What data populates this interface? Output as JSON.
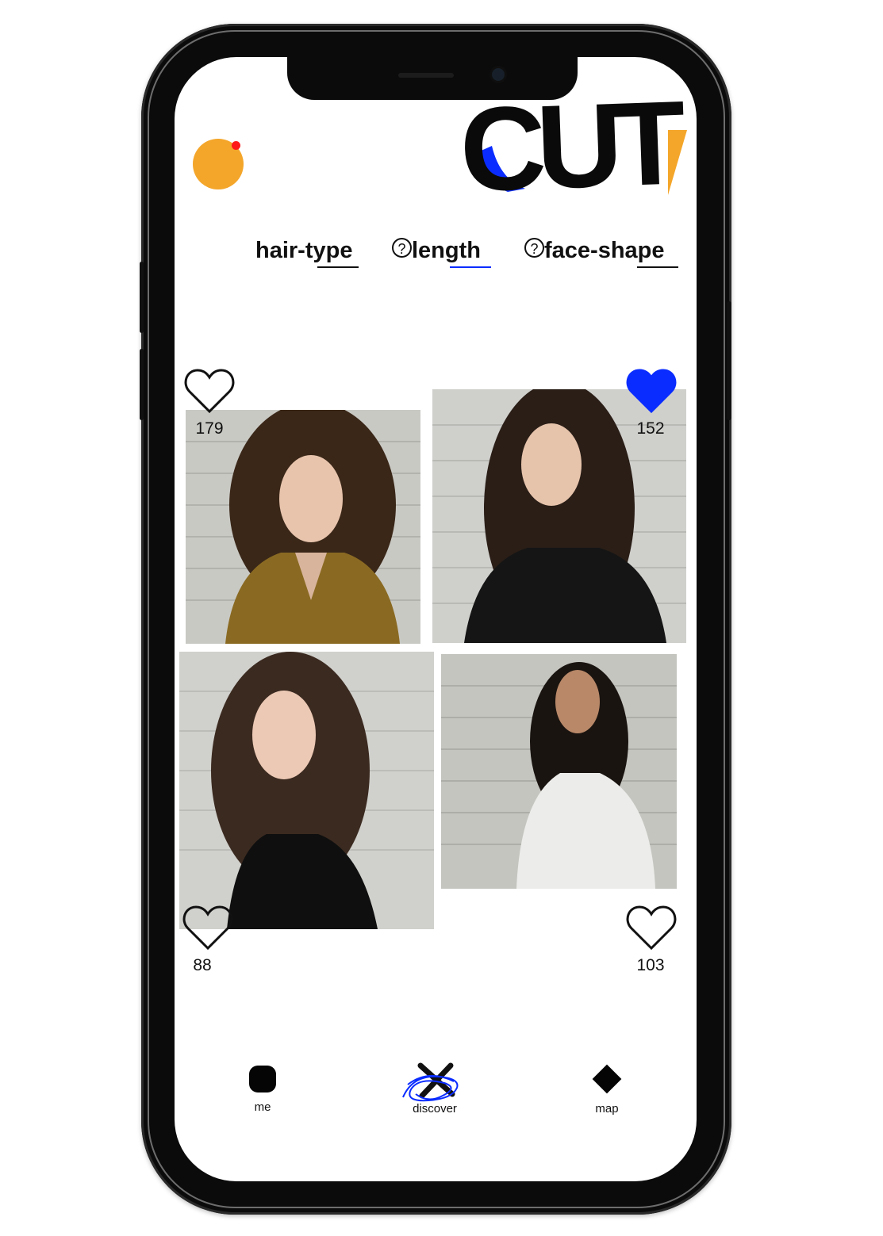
{
  "app": {
    "logo_text": "CUT"
  },
  "colors": {
    "accent_orange": "#f4a62a",
    "accent_blue": "#0a2cff",
    "notification_red": "#ff1a1a"
  },
  "filters": [
    {
      "label": "hair-type",
      "has_help_icon": false
    },
    {
      "label": "length",
      "has_help_icon": true
    },
    {
      "label": "face-shape",
      "has_help_icon": true
    }
  ],
  "help_icon_glyph": "?",
  "photos": [
    {
      "likes": "179",
      "liked": false
    },
    {
      "likes": "152",
      "liked": true
    },
    {
      "likes": "88",
      "liked": false
    },
    {
      "likes": "103",
      "liked": false
    }
  ],
  "nav": [
    {
      "label": "me",
      "icon": "rounded-square-icon"
    },
    {
      "label": "discover",
      "icon": "scribble-icon",
      "active": true
    },
    {
      "label": "map",
      "icon": "diamond-icon"
    }
  ]
}
